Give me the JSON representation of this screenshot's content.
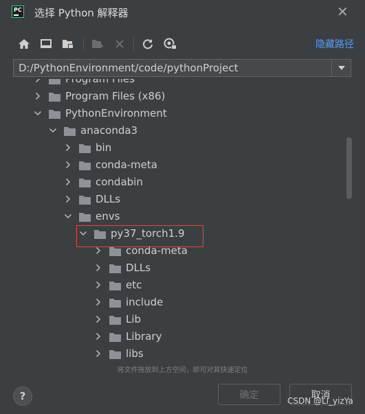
{
  "window": {
    "title": "选择 Python 解释器",
    "app_icon": "pycharm-icon",
    "close_icon": "close-icon"
  },
  "toolbar": {
    "icons": [
      "home-icon",
      "desktop-icon",
      "project-folder-icon",
      "new-folder-icon",
      "delete-icon",
      "refresh-icon",
      "show-hidden-icon"
    ],
    "hide_path_label": "隐藏路径"
  },
  "path": {
    "value": "D:/PythonEnvironment/code/pythonProject"
  },
  "tree": {
    "items": [
      {
        "label": "Program Files",
        "expanded": false
      },
      {
        "label": "Program Files (x86)",
        "expanded": false
      },
      {
        "label": "PythonEnvironment",
        "expanded": true
      },
      {
        "label": "anaconda3",
        "expanded": true
      },
      {
        "label": "bin",
        "expanded": false
      },
      {
        "label": "conda-meta",
        "expanded": false
      },
      {
        "label": "condabin",
        "expanded": false
      },
      {
        "label": "DLLs",
        "expanded": false
      },
      {
        "label": "envs",
        "expanded": true
      },
      {
        "label": "py37_torch1.9",
        "expanded": true,
        "highlighted": true
      },
      {
        "label": "conda-meta",
        "expanded": false
      },
      {
        "label": "DLLs",
        "expanded": false
      },
      {
        "label": "etc",
        "expanded": false
      },
      {
        "label": "include",
        "expanded": false
      },
      {
        "label": "Lib",
        "expanded": false
      },
      {
        "label": "Library",
        "expanded": false
      },
      {
        "label": "libs",
        "expanded": false
      }
    ]
  },
  "hint": "将文件拖放到上方空间，即可对其快速定位",
  "buttons": {
    "help": "?",
    "ok": "确定",
    "cancel": "取消"
  },
  "watermark": "CSDN @Li_yizYa",
  "colors": {
    "background": "#3c3f41",
    "link": "#589df6",
    "highlight_border": "#e0483e",
    "folder": "#8e9297"
  }
}
